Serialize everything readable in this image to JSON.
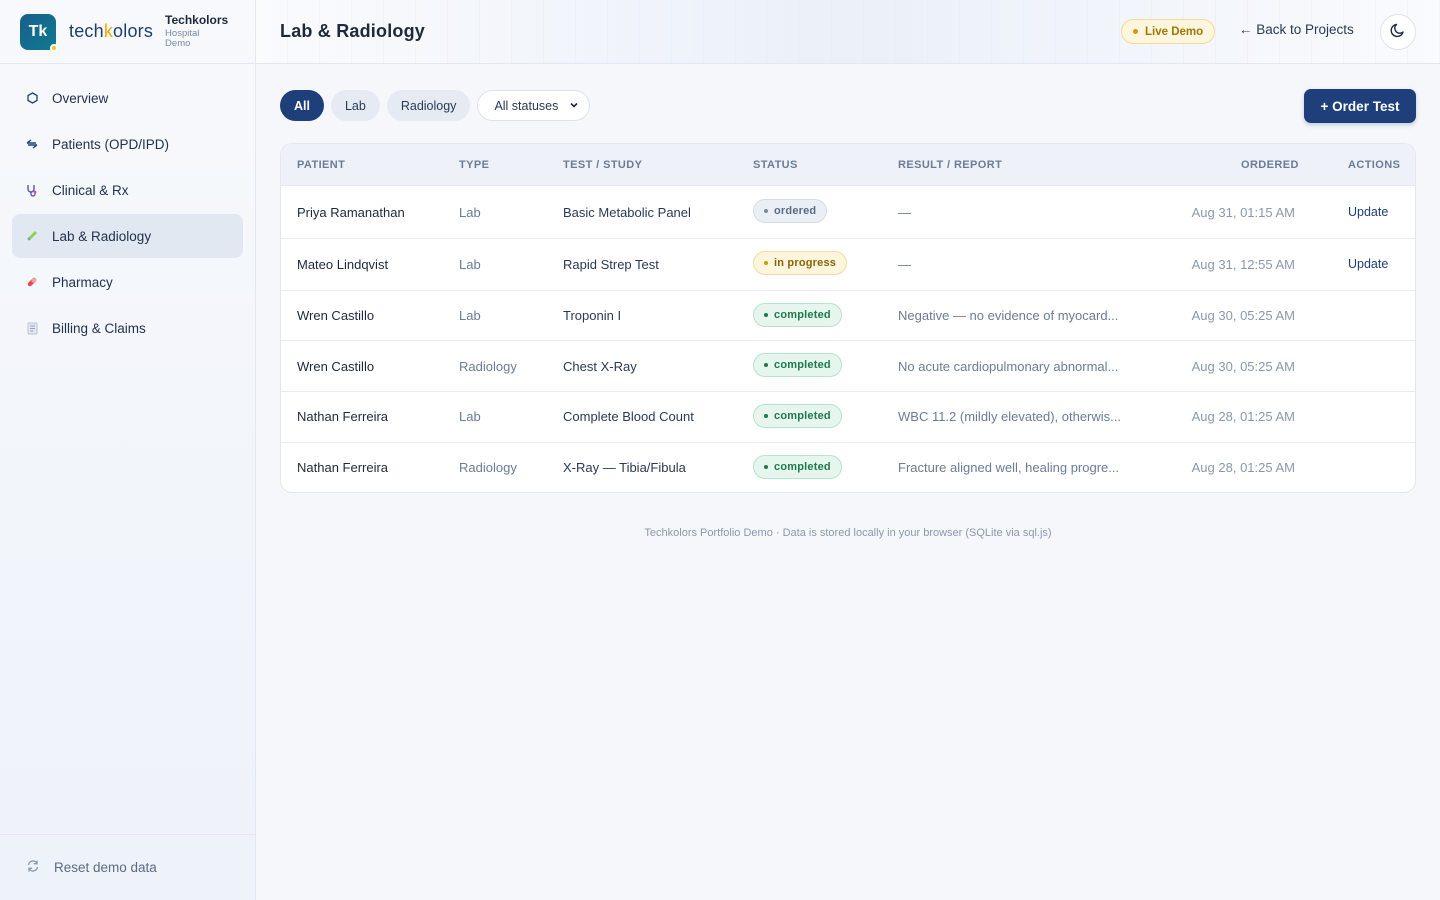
{
  "brand": {
    "logo_initials": "Tk",
    "wordmark_pre": "tech",
    "wordmark_k": "k",
    "wordmark_post": "olors",
    "title": "Techkolors",
    "subtitle_1": "Hospital",
    "subtitle_2": "Demo"
  },
  "sidebar": {
    "items": [
      {
        "label": "Overview",
        "icon": "hexagon-icon"
      },
      {
        "label": "Patients (OPD/IPD)",
        "icon": "transfer-icon"
      },
      {
        "label": "Clinical & Rx",
        "icon": "stethoscope-icon"
      },
      {
        "label": "Lab & Radiology",
        "icon": "test-tube-icon",
        "active": true
      },
      {
        "label": "Pharmacy",
        "icon": "pill-icon"
      },
      {
        "label": "Billing & Claims",
        "icon": "document-icon"
      }
    ],
    "footer_label": "Reset demo data"
  },
  "header": {
    "title": "Lab & Radiology",
    "live_badge": "Live Demo",
    "back_link": "← Back to Projects"
  },
  "filters": {
    "tabs": [
      "All",
      "Lab",
      "Radiology"
    ],
    "active_tab": "All",
    "status_select": "All statuses"
  },
  "order_button": "+ Order Test",
  "table": {
    "columns": [
      "PATIENT",
      "TYPE",
      "TEST / STUDY",
      "STATUS",
      "RESULT / REPORT",
      "ORDERED",
      "ACTIONS"
    ],
    "rows": [
      {
        "patient": "Priya Ramanathan",
        "type": "Lab",
        "test": "Basic Metabolic Panel",
        "status": "ordered",
        "result": "—",
        "ordered": "Aug 31, 01:15 AM",
        "action": "Update"
      },
      {
        "patient": "Mateo Lindqvist",
        "type": "Lab",
        "test": "Rapid Strep Test",
        "status": "in progress",
        "result": "—",
        "ordered": "Aug 31, 12:55 AM",
        "action": "Update"
      },
      {
        "patient": "Wren Castillo",
        "type": "Lab",
        "test": "Troponin I",
        "status": "completed",
        "result": "Negative — no evidence of myocard...",
        "ordered": "Aug 30, 05:25 AM",
        "action": ""
      },
      {
        "patient": "Wren Castillo",
        "type": "Radiology",
        "test": "Chest X-Ray",
        "status": "completed",
        "result": "No acute cardiopulmonary abnormal...",
        "ordered": "Aug 30, 05:25 AM",
        "action": ""
      },
      {
        "patient": "Nathan Ferreira",
        "type": "Lab",
        "test": "Complete Blood Count",
        "status": "completed",
        "result": "WBC 11.2 (mildly elevated), otherwis...",
        "ordered": "Aug 28, 01:25 AM",
        "action": ""
      },
      {
        "patient": "Nathan Ferreira",
        "type": "Radiology",
        "test": "X-Ray — Tibia/Fibula",
        "status": "completed",
        "result": "Fracture aligned well, healing progre...",
        "ordered": "Aug 28, 01:25 AM",
        "action": ""
      }
    ]
  },
  "footer_note": "Techkolors Portfolio Demo · Data is stored locally in your browser (SQLite via sql.js)",
  "colors": {
    "primary": "#1e3f7a",
    "live_badge": "#fdf5dc",
    "completed": "#1d7a4c",
    "in_progress": "#8a6406"
  }
}
